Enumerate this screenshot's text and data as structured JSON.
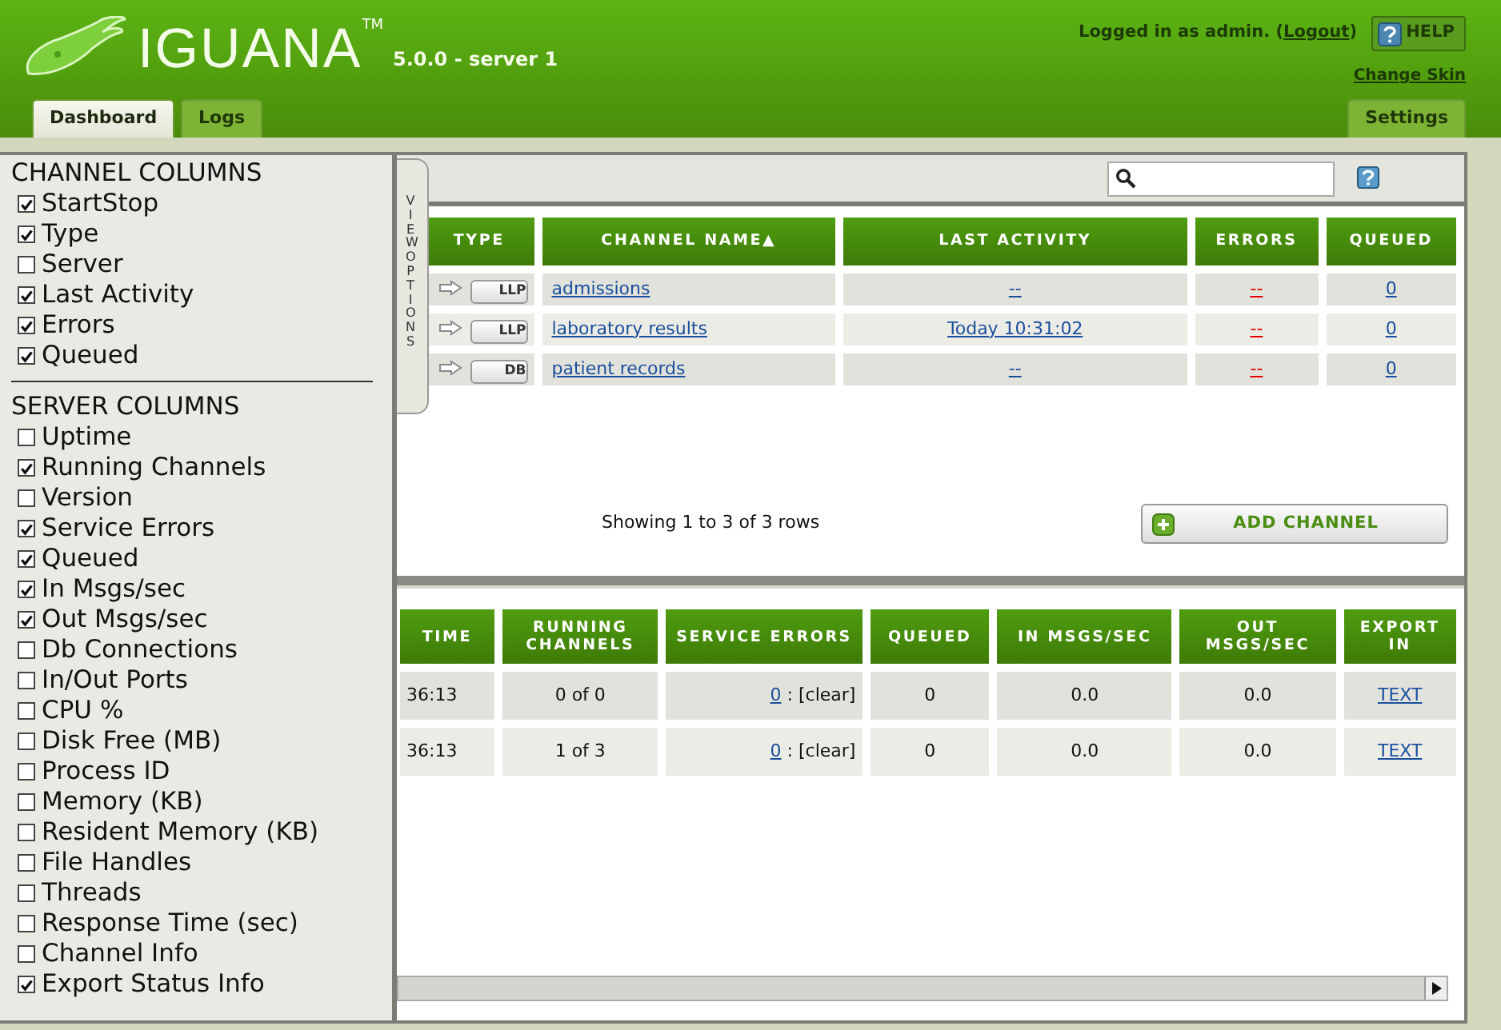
{
  "header": {
    "product": "IGUANA",
    "trademark": "TM",
    "version": "5.0.0 - server 1",
    "login": {
      "before": "Logged in as admin. (",
      "link": "Logout",
      "after": ")"
    },
    "help_button": "HELP",
    "change_skin": "Change Skin"
  },
  "tabs": [
    {
      "label": "Dashboard",
      "selected": true
    },
    {
      "label": "Logs",
      "selected": false
    }
  ],
  "right_tabs": [
    {
      "label": "Settings",
      "selected": false
    }
  ],
  "view_options": {
    "tab_label": "VIEW OPTIONS",
    "sections": [
      {
        "title": "CHANNEL COLUMNS",
        "items": [
          {
            "label": "StartStop",
            "checked": true
          },
          {
            "label": "Type",
            "checked": true
          },
          {
            "label": "Server",
            "checked": false
          },
          {
            "label": "Last Activity",
            "checked": true
          },
          {
            "label": "Errors",
            "checked": true
          },
          {
            "label": "Queued",
            "checked": true
          }
        ]
      },
      {
        "title": "SERVER COLUMNS",
        "items": [
          {
            "label": "Uptime",
            "checked": false
          },
          {
            "label": "Running Channels",
            "checked": true
          },
          {
            "label": "Version",
            "checked": false
          },
          {
            "label": "Service Errors",
            "checked": true
          },
          {
            "label": "Queued",
            "checked": true
          },
          {
            "label": "In Msgs/sec",
            "checked": true
          },
          {
            "label": "Out Msgs/sec",
            "checked": true
          },
          {
            "label": "Db Connections",
            "checked": false
          },
          {
            "label": "In/Out Ports",
            "checked": false
          },
          {
            "label": "CPU %",
            "checked": false
          },
          {
            "label": "Disk Free (MB)",
            "checked": false
          },
          {
            "label": "Process ID",
            "checked": false
          },
          {
            "label": "Memory (KB)",
            "checked": false
          },
          {
            "label": "Resident Memory (KB)",
            "checked": false
          },
          {
            "label": "File Handles",
            "checked": false
          },
          {
            "label": "Threads",
            "checked": false
          },
          {
            "label": "Response Time (sec)",
            "checked": false
          },
          {
            "label": "Channel Info",
            "checked": false
          },
          {
            "label": "Export Status Info",
            "checked": true
          }
        ]
      }
    ]
  },
  "channels": {
    "columns": [
      "TYPE",
      "CHANNEL NAME▲",
      "LAST ACTIVITY",
      "ERRORS",
      "QUEUED"
    ],
    "rows": [
      {
        "type": "LLP",
        "name": "admissions",
        "last_activity": "--",
        "errors": "--",
        "queued": "0"
      },
      {
        "type": "LLP",
        "name": "laboratory results",
        "last_activity": "Today 10:31:02",
        "errors": "--",
        "queued": "0"
      },
      {
        "type": "DB",
        "name": "patient records",
        "last_activity": "--",
        "errors": "--",
        "queued": "0"
      }
    ],
    "summary": "Showing 1 to 3 of 3 rows",
    "add_button": "ADD CHANNEL"
  },
  "servers": {
    "columns": [
      "TIME",
      "RUNNING CHANNELS",
      "SERVICE ERRORS",
      "QUEUED",
      "IN MSGS/SEC",
      "OUT MSGS/SEC",
      "EXPORT IN"
    ],
    "rows": [
      {
        "time": "36:13",
        "running_channels": "0 of 0",
        "service_errors": "0",
        "clear": ": [clear]",
        "queued": "0",
        "in_msgs": "0.0",
        "out_msgs": "0.0",
        "export": "TEXT"
      },
      {
        "time": "36:13",
        "running_channels": "1 of 3",
        "service_errors": "0",
        "clear": ": [clear]",
        "queued": "0",
        "in_msgs": "0.0",
        "out_msgs": "0.0",
        "export": "TEXT"
      }
    ]
  }
}
